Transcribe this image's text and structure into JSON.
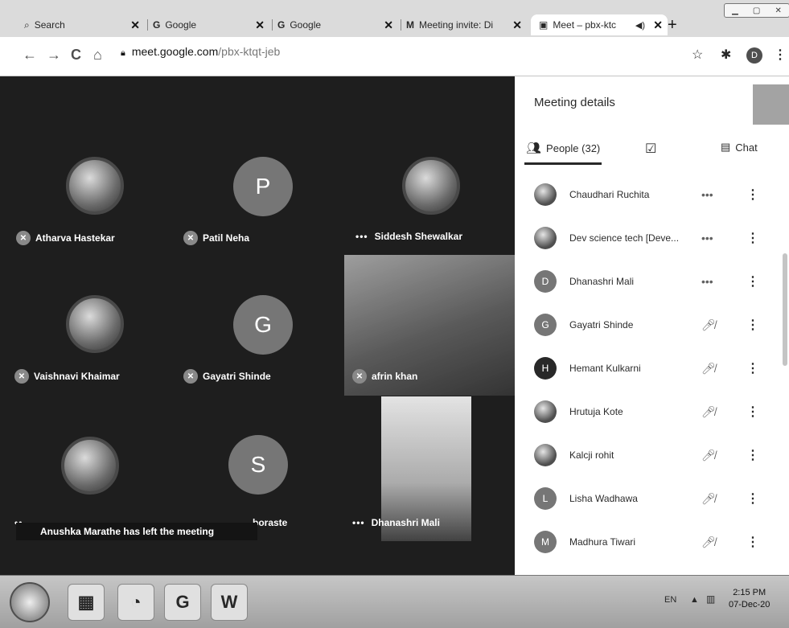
{
  "browser": {
    "tabs": [
      {
        "label": "Search",
        "icon": "search-icon",
        "active": false
      },
      {
        "label": "Google",
        "icon": "google-icon",
        "active": false
      },
      {
        "label": "Google",
        "icon": "google-icon",
        "active": false
      },
      {
        "label": "Meeting invite: Di",
        "icon": "gmail-icon",
        "active": false
      },
      {
        "label": "Meet – pbx-ktc",
        "icon": "meet-icon",
        "active": true
      }
    ],
    "url_domain": "meet.google.com",
    "url_path": "/pbx-ktqt-jeb",
    "profile_initial": "D"
  },
  "meeting": {
    "tiles": [
      {
        "name": "Atharva Hastekar",
        "avatar": "photo",
        "muted": true
      },
      {
        "name": "Patil Neha",
        "avatar": "letter",
        "letter": "P",
        "muted": true
      },
      {
        "name": "Siddesh Shewalkar",
        "avatar": "photo",
        "muted": false
      },
      {
        "name": "Vaishnavi Khaimar",
        "avatar": "photo",
        "muted": true
      },
      {
        "name": "Gayatri Shinde",
        "avatar": "letter",
        "letter": "G",
        "muted": true
      },
      {
        "name": "afrin khan",
        "avatar": "video",
        "muted": true
      },
      {
        "name": "",
        "avatar": "photo",
        "muted": false
      },
      {
        "name": "boraste",
        "avatar": "letter",
        "letter": "S",
        "muted": false
      },
      {
        "name": "Dhanashri Mali",
        "avatar": "video",
        "muted": false
      }
    ],
    "toast": "Anushka Marathe has left the meeting"
  },
  "panel": {
    "title": "Meeting details",
    "tab_people": "People (32)",
    "tab_chat": "Chat",
    "people": [
      {
        "name": "Chaudhari Ruchita",
        "avatar": "photo",
        "status": "•••"
      },
      {
        "name": "Dev science tech [Deve...",
        "avatar": "photo",
        "status": "•••"
      },
      {
        "name": "Dhanashri Mali",
        "avatar": "letter",
        "letter": "D",
        "status": "•••"
      },
      {
        "name": "Gayatri Shinde",
        "avatar": "letter",
        "letter": "G",
        "status": "muted"
      },
      {
        "name": "Hemant Kulkarni",
        "avatar": "letter",
        "letter": "H",
        "status": "muted"
      },
      {
        "name": "Hrutuja Kote",
        "avatar": "photo",
        "status": "muted"
      },
      {
        "name": "Kalcji rohit",
        "avatar": "photo",
        "status": "muted"
      },
      {
        "name": "Lisha Wadhawa",
        "avatar": "letter",
        "letter": "L",
        "status": "muted"
      },
      {
        "name": "Madhura Tiwari",
        "avatar": "letter",
        "letter": "M",
        "status": "muted"
      }
    ]
  },
  "taskbar": {
    "tray_lang": "EN",
    "clock_time": "2:15 PM",
    "clock_date": "07-Dec-20"
  }
}
